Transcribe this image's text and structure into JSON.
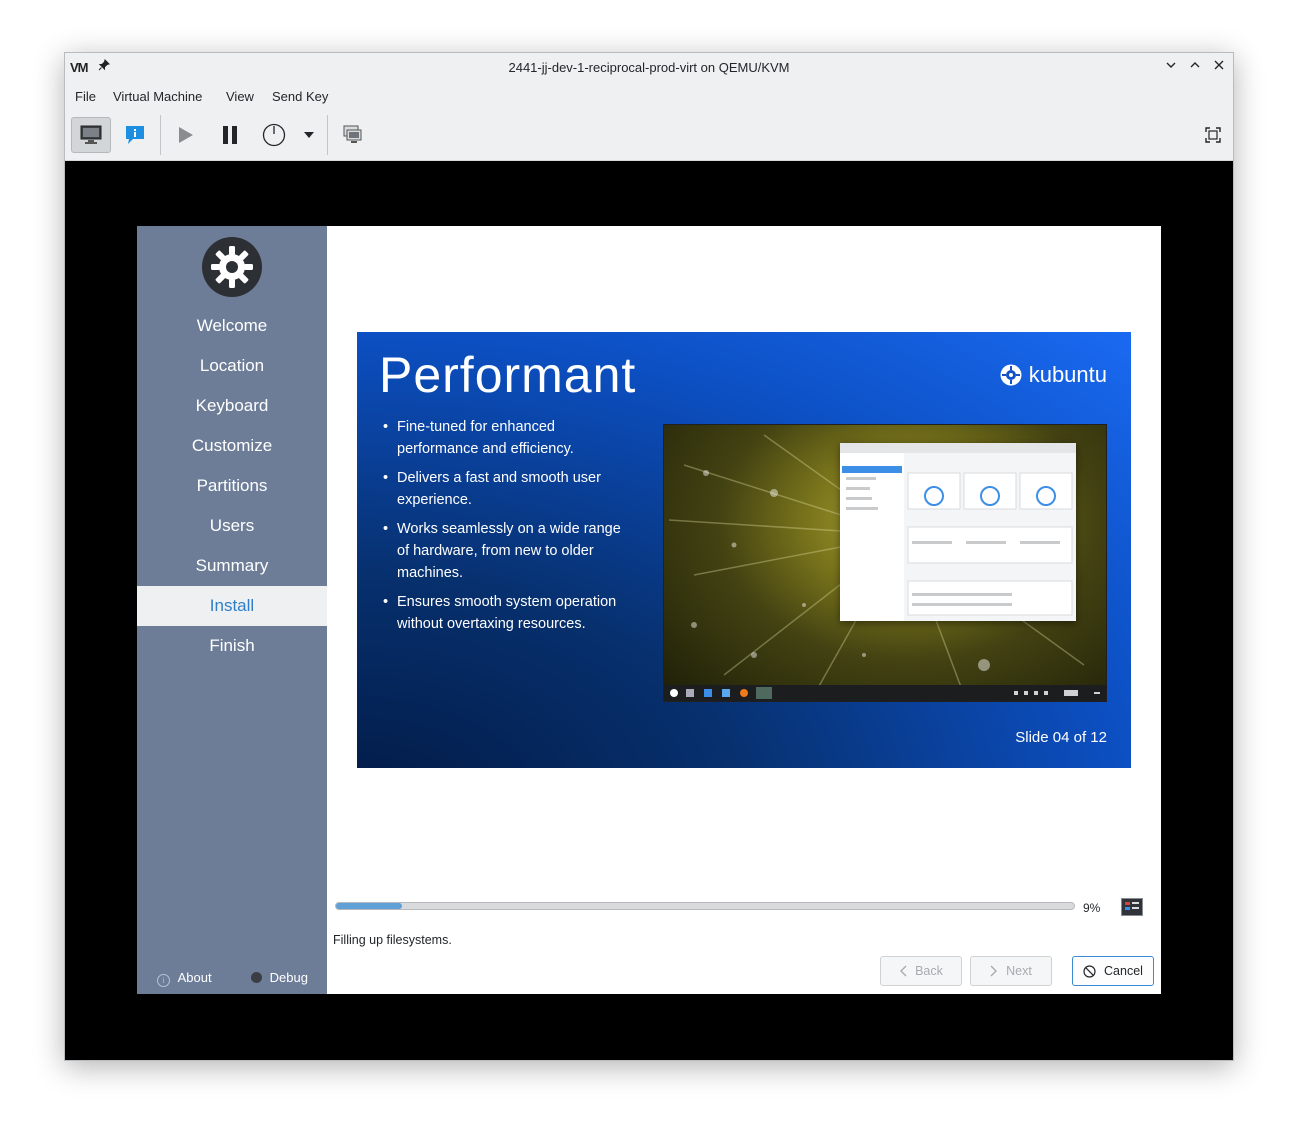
{
  "window": {
    "logo": "VM",
    "title": "2441-jj-dev-1-reciprocal-prod-virt on QEMU/KVM"
  },
  "menubar": {
    "items": [
      "File",
      "Virtual Machine",
      "View",
      "Send Key"
    ]
  },
  "installer": {
    "steps": [
      "Welcome",
      "Location",
      "Keyboard",
      "Customize",
      "Partitions",
      "Users",
      "Summary",
      "Install",
      "Finish"
    ],
    "active_step": "Install",
    "about_label": "About",
    "debug_label": "Debug",
    "slide": {
      "title": "Performant",
      "brand": "kubuntu",
      "bullets": [
        "Fine-tuned for enhanced performance and efficiency.",
        "Delivers a fast and smooth user experience.",
        "Works seamlessly on a wide range of hardware, from new to older machines.",
        "Ensures smooth system operation without overtaxing resources."
      ],
      "counter": "Slide 04 of 12"
    },
    "progress": {
      "percent": 9,
      "label": "9%"
    },
    "status_text": "Filling up filesystems.",
    "buttons": {
      "back": "Back",
      "next": "Next",
      "cancel": "Cancel"
    }
  },
  "colors": {
    "sidebar_bg": "#6d7d98",
    "accent": "#2f7fc8",
    "progress_fill": "#5fa0d7"
  }
}
